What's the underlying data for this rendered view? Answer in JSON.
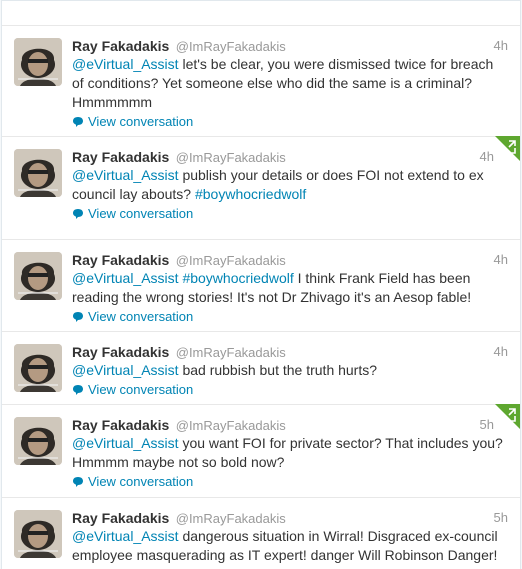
{
  "user": {
    "name": "Ray Fakadakis",
    "handle": "@ImRayFakadakis"
  },
  "expand_label": "View conversation",
  "colors": {
    "link": "#0084b4",
    "retweet_corner": "#5ea72f"
  },
  "tweets": [
    {
      "time": "4h",
      "mention": "@eVirtual_Assist",
      "text": " let's be clear, you were dismissed twice for breach of conditions? Yet someone else who did the same is a criminal? Hmmmmmm",
      "retweeted": false
    },
    {
      "time": "4h",
      "mention": "@eVirtual_Assist",
      "text": " publish your details or does FOI not extend to ex council lay abouts? ",
      "hashtag": "#boywhocriedwolf",
      "retweeted": true
    },
    {
      "time": "4h",
      "mention": "@eVirtual_Assist",
      "hashtag_inline": "#boywhocriedwolf",
      "text": " I think Frank Field has been reading the wrong stories! It's not Dr Zhivago it's an Aesop fable!",
      "retweeted": false
    },
    {
      "time": "4h",
      "mention": "@eVirtual_Assist",
      "text": " bad rubbish but the truth hurts?",
      "retweeted": false
    },
    {
      "time": "5h",
      "mention": "@eVirtual_Assist",
      "text": " you want FOI for private sector? That includes you? Hmmmm maybe not so bold now?",
      "retweeted": true
    },
    {
      "time": "5h",
      "mention": "@eVirtual_Assist",
      "text": " dangerous situation in Wirral! Disgraced ex-council employee masquerading as IT expert! danger Will Robinson Danger!",
      "retweeted": false
    }
  ]
}
